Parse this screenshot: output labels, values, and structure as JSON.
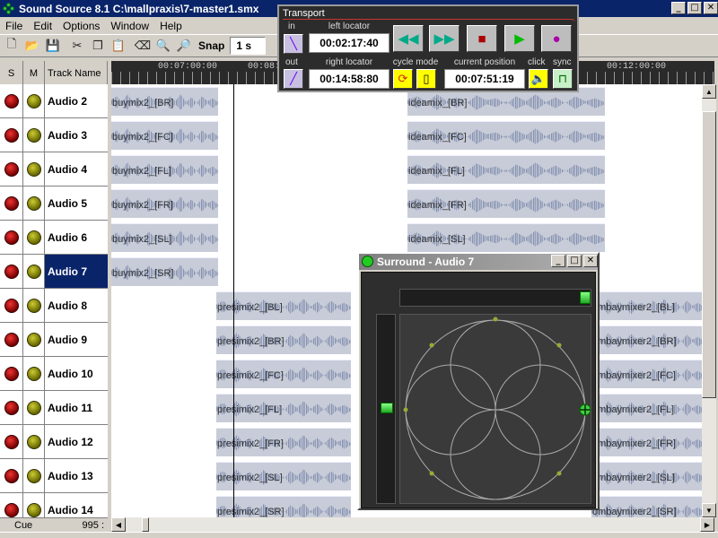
{
  "window": {
    "title": "Sound Source 8.1 C:\\mallpraxis\\7-master1.smx",
    "btn_min": "_",
    "btn_max": "□",
    "btn_close": "✕"
  },
  "menu": [
    "File",
    "Edit",
    "Options",
    "Window",
    "Help"
  ],
  "toolbar": {
    "snap_label": "Snap",
    "snap_value": "1 s"
  },
  "track_header": {
    "s": "S",
    "m": "M",
    "name": "Track Name"
  },
  "tracks": [
    {
      "name": "Audio 2",
      "selected": false
    },
    {
      "name": "Audio 3",
      "selected": false
    },
    {
      "name": "Audio 4",
      "selected": false
    },
    {
      "name": "Audio 5",
      "selected": false
    },
    {
      "name": "Audio 6",
      "selected": false
    },
    {
      "name": "Audio 7",
      "selected": true
    },
    {
      "name": "Audio 8",
      "selected": false
    },
    {
      "name": "Audio 9",
      "selected": false
    },
    {
      "name": "Audio 10",
      "selected": false
    },
    {
      "name": "Audio 11",
      "selected": false
    },
    {
      "name": "Audio 12",
      "selected": false
    },
    {
      "name": "Audio 13",
      "selected": false
    },
    {
      "name": "Audio 14",
      "selected": false
    }
  ],
  "ruler_labels": [
    "00:07:00:00",
    "00:08:0",
    "00:12:00:00"
  ],
  "clips": {
    "r0": [
      "buymix2_[BR]",
      "ideamix_[BR]"
    ],
    "r1": [
      "buymix2_[FC]",
      "ideamix_[FC]"
    ],
    "r2": [
      "buymix2_[FL]",
      "ideamix_[FL]"
    ],
    "r3": [
      "buymix2_[FR]",
      "ideamix_[FR]"
    ],
    "r4": [
      "buymix2_[SL]",
      "ideamix_[SL]"
    ],
    "r5": [
      "buymix2_[SR]"
    ],
    "r6": [
      "presimix2_[BL]",
      "ombaymixer2_[BL]"
    ],
    "r7": [
      "presimix2_[BR]",
      "ombaymixer2_[BR]"
    ],
    "r8": [
      "presimix2_[FC]",
      "ombaymixer2_[FC]"
    ],
    "r9": [
      "presimix2_[FL]",
      "ombaymixer2_[FL]"
    ],
    "r10": [
      "presimix2_[FR]",
      "ombaymixer2_[FR]"
    ],
    "r11": [
      "presimix2_[SL]",
      "ombaymixer2_[SL]"
    ],
    "r12": [
      "presimix2_[SR]",
      "ombaymixer2_[SR]"
    ]
  },
  "status": {
    "cue_label": "Cue",
    "cue_value": "995 :"
  },
  "transport": {
    "title": "Transport",
    "in_label": "in",
    "out_label": "out",
    "left_locator_label": "left locator",
    "left_locator": "00:02:17:40",
    "right_locator_label": "right locator",
    "right_locator": "00:14:58:80",
    "cycle_mode_label": "cycle mode",
    "current_position_label": "current position",
    "current_position": "00:07:51:19",
    "click_label": "click",
    "sync_label": "sync"
  },
  "surround": {
    "title": "Surround - Audio 7"
  }
}
